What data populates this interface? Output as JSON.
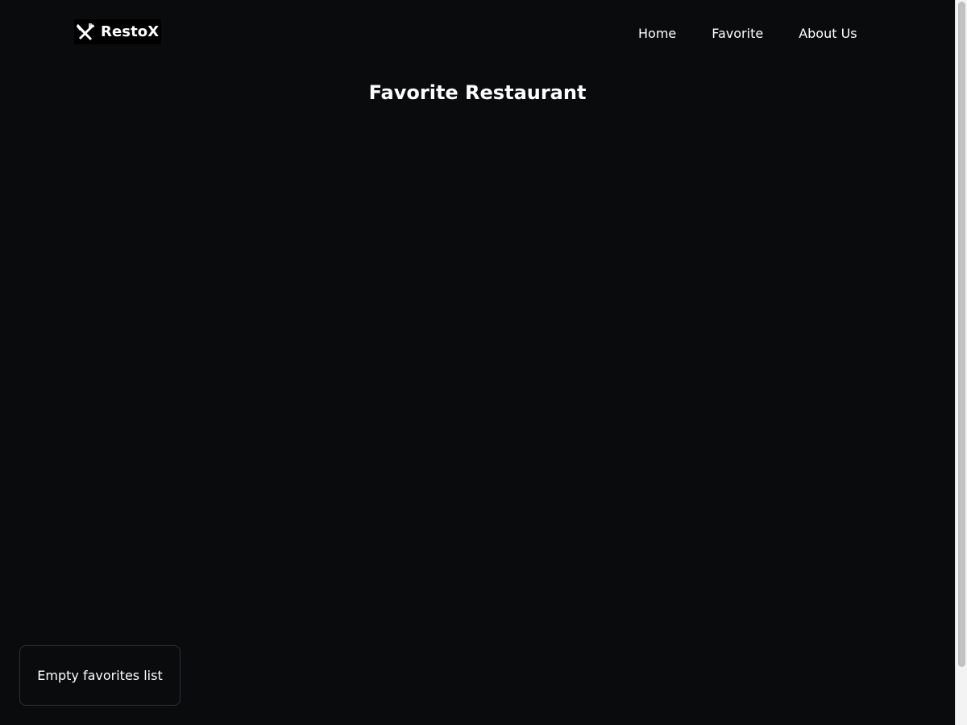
{
  "brand": {
    "name": "RestoX",
    "icon": "fork-knife-icon"
  },
  "nav": {
    "items": [
      {
        "label": "Home"
      },
      {
        "label": "Favorite"
      },
      {
        "label": "About Us"
      }
    ]
  },
  "main": {
    "title": "Favorite Restaurant"
  },
  "toast": {
    "message": "Empty favorites list"
  },
  "colors": {
    "background": "#0a0b0d",
    "text": "#ffffff",
    "toast_border": "#2e3036",
    "brand_bg": "#000000"
  }
}
